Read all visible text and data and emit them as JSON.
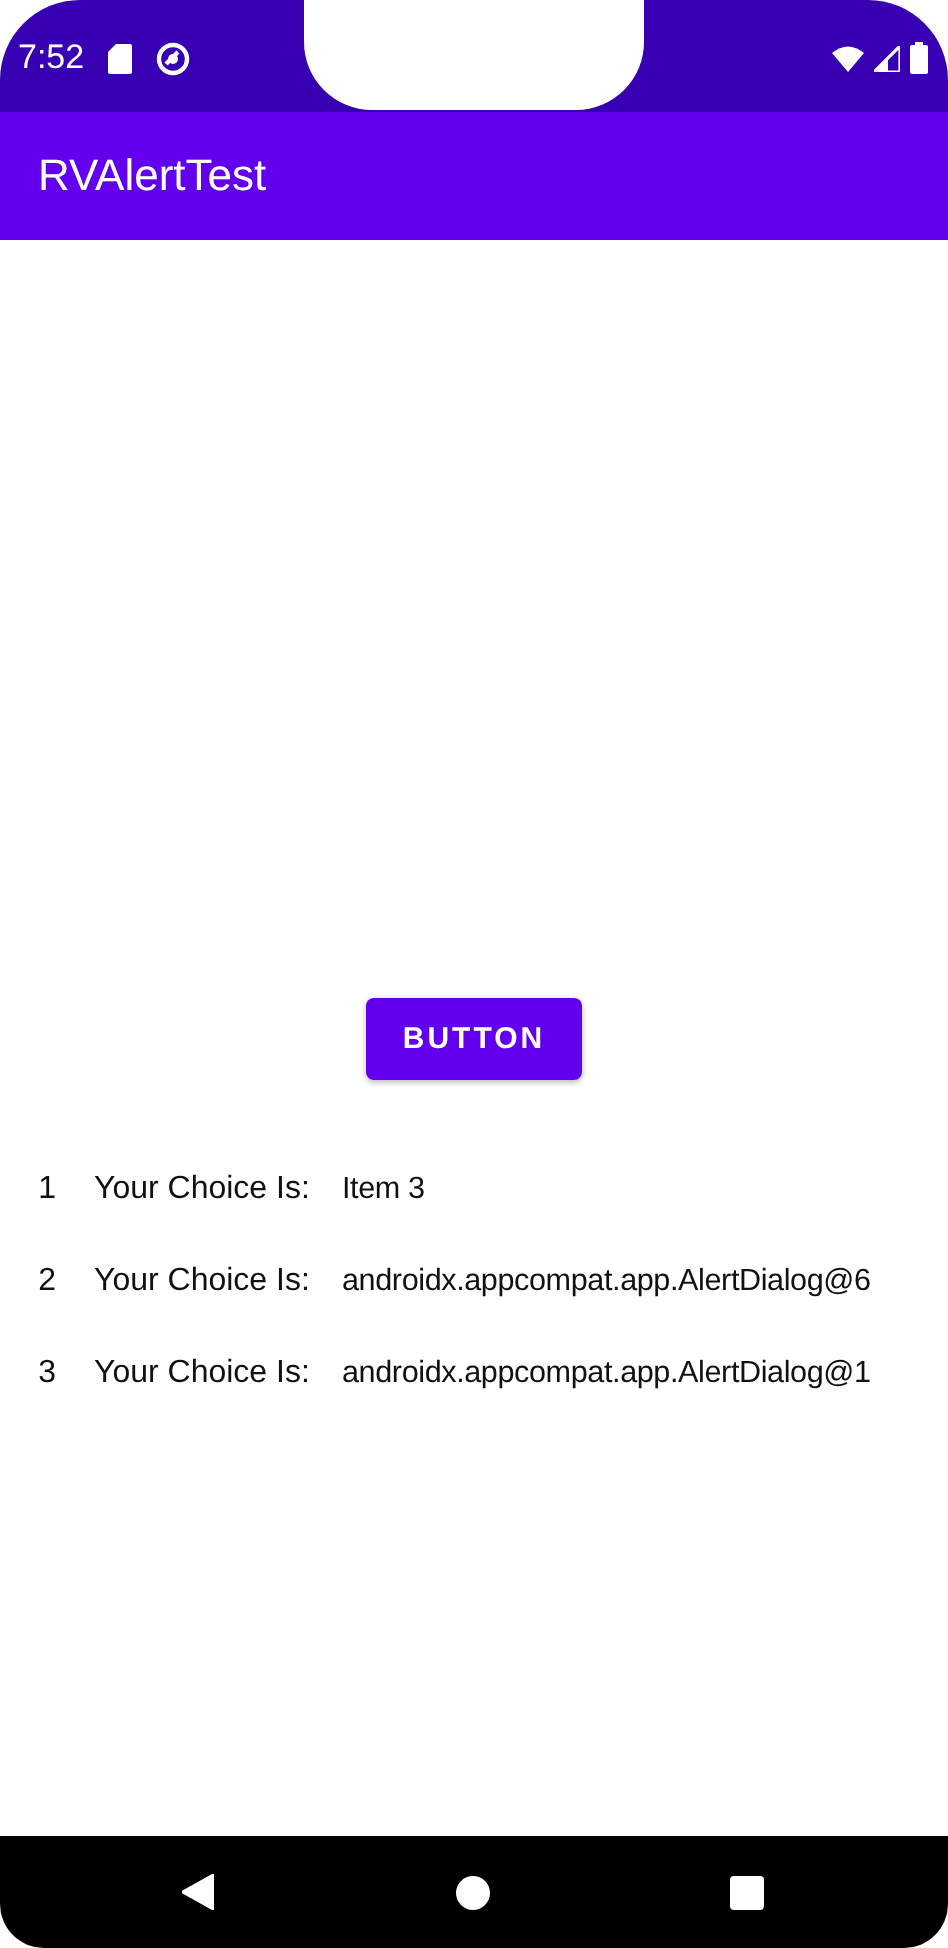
{
  "status_bar": {
    "time": "7:52"
  },
  "app_bar": {
    "title": "RVAlertTest"
  },
  "button": {
    "label": "BUTTON"
  },
  "rows": [
    {
      "number": "1",
      "label": "Your Choice Is:",
      "value": "Item 3"
    },
    {
      "number": "2",
      "label": "Your Choice Is:",
      "value": "androidx.appcompat.app.AlertDialog@6"
    },
    {
      "number": "3",
      "label": "Your Choice Is:",
      "value": "androidx.appcompat.app.AlertDialog@1"
    }
  ]
}
